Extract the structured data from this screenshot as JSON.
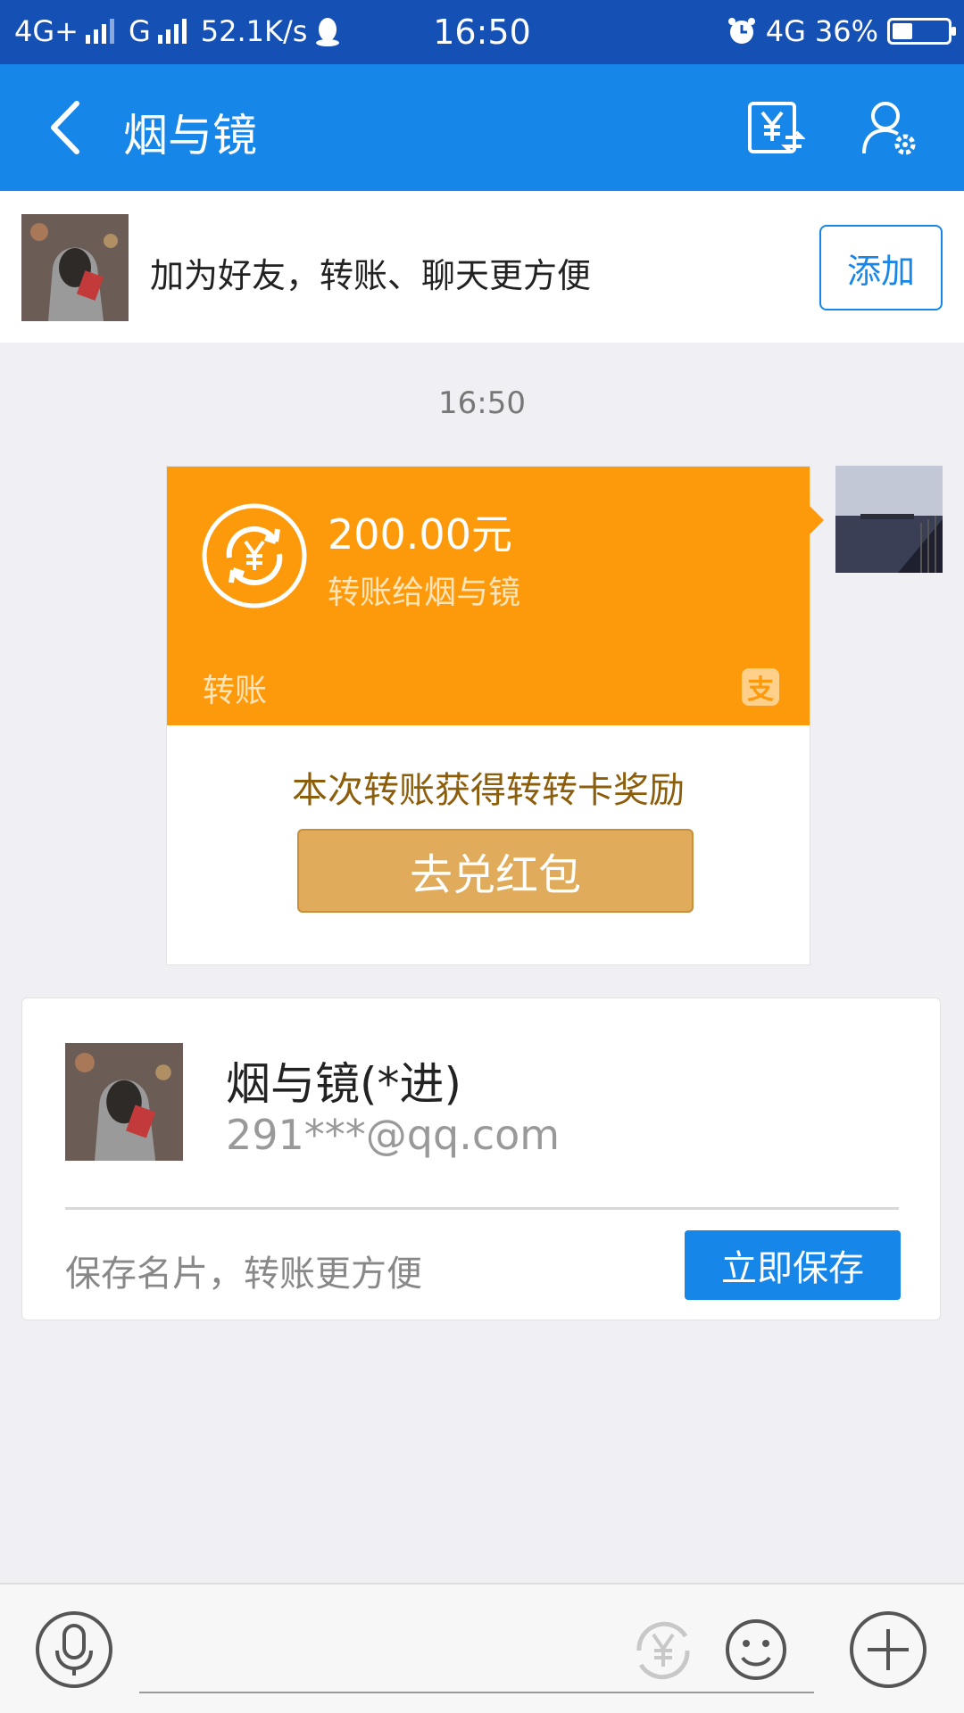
{
  "status_bar": {
    "network1": "4G+",
    "network2": "G",
    "speed": "52.1K/s",
    "time": "16:50",
    "network3": "4G",
    "battery": "36%",
    "battery_level": 0.36
  },
  "header": {
    "title": "烟与镜",
    "icons": [
      "back-icon",
      "transfer-record-icon",
      "chat-settings-icon"
    ]
  },
  "add_friend": {
    "text": "加为好友，转账、聊天更方便",
    "button_label": "添加"
  },
  "chat": {
    "timestamp": "16:50",
    "transfer": {
      "amount": "200.00元",
      "description": "转账给烟与镜",
      "kind": "转账",
      "reward_text": "本次转账获得转转卡奖励",
      "reward_button": "去兑红包",
      "alipay_glyph": "支",
      "color": "#fd9a0c"
    }
  },
  "contact_card": {
    "name": "烟与镜(*进)",
    "email": "291***@qq.com",
    "hint": "保存名片，转账更方便",
    "save_button": "立即保存"
  },
  "input_bar": {
    "icons": [
      "microphone-icon",
      "yuan-transfer-icon",
      "emoji-icon",
      "plus-icon"
    ]
  },
  "colors": {
    "status_bar": "#1550b5",
    "title_bar": "#1686e8",
    "accent": "#1686e8",
    "transfer_card": "#fd9a0c",
    "reward_button": "#e0ab5a"
  }
}
